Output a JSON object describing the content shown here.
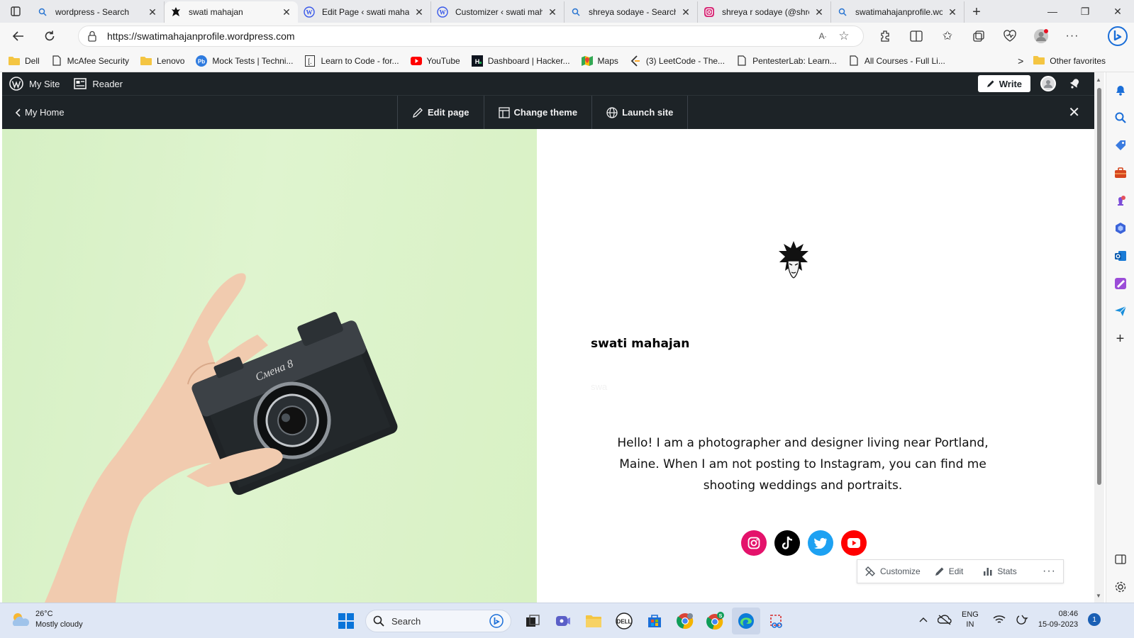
{
  "browser": {
    "tabs": [
      {
        "title": "wordpress - Search",
        "icon": "search-icon",
        "active": false
      },
      {
        "title": "swati mahajan",
        "icon": "goku-favicon",
        "active": true
      },
      {
        "title": "Edit Page ‹ swati mahaja",
        "icon": "wordpress-icon",
        "active": false
      },
      {
        "title": "Customizer ‹ swati mah",
        "icon": "wordpress-icon",
        "active": false
      },
      {
        "title": "shreya sodaye - Search",
        "icon": "search-icon",
        "active": false
      },
      {
        "title": "shreya r sodaye (@shrey",
        "icon": "instagram-icon",
        "active": false
      },
      {
        "title": "swatimahajanprofile.wo",
        "icon": "search-icon",
        "active": false
      }
    ],
    "new_tab": "+",
    "url": "https://swatimahajanprofile.wordpress.com",
    "favorites": [
      {
        "label": "Dell",
        "icon": "folder-icon"
      },
      {
        "label": "McAfee Security",
        "icon": "page-icon"
      },
      {
        "label": "Lenovo",
        "icon": "folder-icon"
      },
      {
        "label": "Mock Tests | Techni...",
        "icon": "mock-tests-icon"
      },
      {
        "label": "Learn to Code - for...",
        "icon": "freecodecamp-icon"
      },
      {
        "label": "YouTube",
        "icon": "youtube-icon"
      },
      {
        "label": "Dashboard | Hacker...",
        "icon": "hackerrank-icon"
      },
      {
        "label": "Maps",
        "icon": "maps-icon"
      },
      {
        "label": "(3) LeetCode - The...",
        "icon": "leetcode-icon"
      },
      {
        "label": "PentesterLab: Learn...",
        "icon": "page-icon"
      },
      {
        "label": "All Courses - Full Li...",
        "icon": "page-icon"
      }
    ],
    "favorites_more": ">",
    "other_favorites": "Other favorites"
  },
  "wp_admin": {
    "my_site": "My Site",
    "reader": "Reader",
    "write": "Write"
  },
  "preview_bar": {
    "back": "My Home",
    "edit_page": "Edit page",
    "change_theme": "Change theme",
    "launch_site": "Launch site"
  },
  "site": {
    "title": "swati mahajan",
    "tagline": "swa",
    "bio": "Hello! I am a photographer and designer living near Portland, Maine. When I am not posting to Instagram, you can find me shooting weddings and portraits.",
    "social": [
      {
        "name": "instagram",
        "color": "#e4126b"
      },
      {
        "name": "tiktok",
        "color": "#000000"
      },
      {
        "name": "twitter",
        "color": "#1da1f2"
      },
      {
        "name": "youtube",
        "color": "#ff0000"
      }
    ]
  },
  "action_bar": {
    "customize": "Customize",
    "edit": "Edit",
    "stats": "Stats"
  },
  "taskbar": {
    "temperature": "26°C",
    "weather": "Mostly cloudy",
    "search": "Search",
    "lang_top": "ENG",
    "lang_bottom": "IN",
    "time": "08:46",
    "date": "15-09-2023",
    "notifications": "1"
  }
}
